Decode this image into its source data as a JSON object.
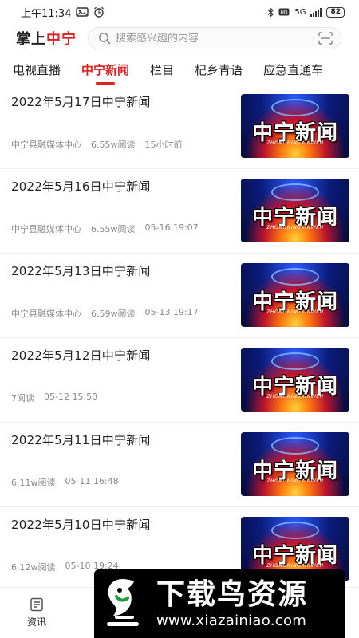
{
  "status_bar": {
    "time": "上午11:34",
    "network": "5G",
    "battery": "82"
  },
  "header": {
    "logo_prefix": "掌上",
    "logo_highlight": "中宁",
    "search_placeholder": "搜索感兴趣的内容"
  },
  "tabs": [
    {
      "label": "电视直播"
    },
    {
      "label": "中宁新闻"
    },
    {
      "label": "栏目"
    },
    {
      "label": "杞乡青语"
    },
    {
      "label": "应急直通车"
    }
  ],
  "thumbnail": {
    "title": "中宁新闻",
    "pinyin": "ZHONGNINGXINWEN"
  },
  "news": [
    {
      "title": "2022年5月17日中宁新闻",
      "source": "中宁县融媒体中心",
      "reads": "6.55w阅读",
      "time": "15小时前"
    },
    {
      "title": "2022年5月16日中宁新闻",
      "source": "中宁县融媒体中心",
      "reads": "6.55w阅读",
      "time": "05-16 19:07"
    },
    {
      "title": "2022年5月13日中宁新闻",
      "source": "中宁县融媒体中心",
      "reads": "6.59w阅读",
      "time": "05-13 19:17"
    },
    {
      "title": "2022年5月12日中宁新闻",
      "source": "",
      "reads": "7阅读",
      "time": "05-12 15:50"
    },
    {
      "title": "2022年5月11日中宁新闻",
      "source": "",
      "reads": "6.11w阅读",
      "time": "05-11 16:48"
    },
    {
      "title": "2022年5月10日中宁新闻",
      "source": "",
      "reads": "6.12w阅读",
      "time": "05-10 19:24"
    }
  ],
  "bottom_nav": {
    "info_label": "资讯"
  },
  "watermark": {
    "title": "下载鸟资源",
    "url": "www.xiazainiao.com"
  },
  "colors": {
    "accent": "#e02020",
    "meta_text": "#8a8a8a"
  }
}
